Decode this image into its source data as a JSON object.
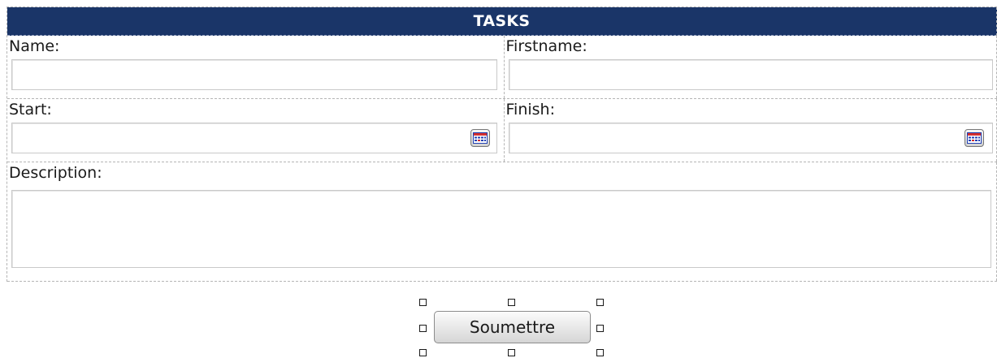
{
  "form": {
    "title": "TASKS",
    "name": {
      "label": "Name:",
      "value": ""
    },
    "firstname": {
      "label": "Firstname:",
      "value": ""
    },
    "start": {
      "label": "Start:",
      "value": ""
    },
    "finish": {
      "label": "Finish:",
      "value": ""
    },
    "description": {
      "label": "Description:",
      "value": ""
    },
    "submit_label": "Soumettre"
  },
  "icons": {
    "date_picker": "calendar-icon",
    "selection": "resize-handle"
  },
  "colors": {
    "header_background": "#1a3568",
    "header_text": "#ffffff",
    "cell_border": "#b5b5b5",
    "input_border": "#c9c9c9",
    "calendar_red": "#d32f2f",
    "calendar_blue": "#1f3fb2"
  }
}
